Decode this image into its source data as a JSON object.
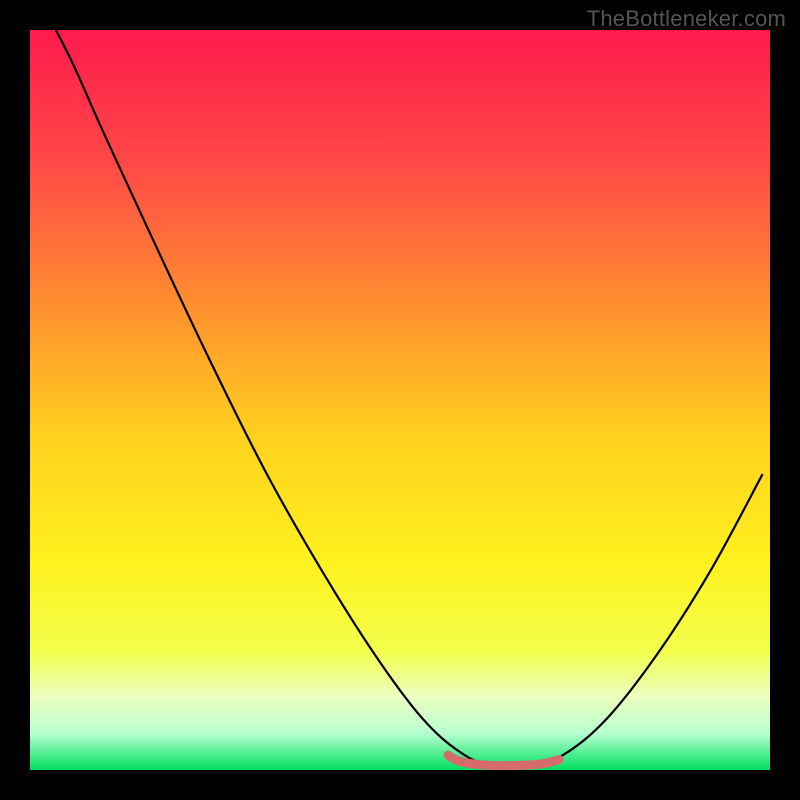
{
  "watermark": "TheBottleneker.com",
  "chart_data": {
    "type": "line",
    "title": "",
    "xlabel": "",
    "ylabel": "",
    "xlim": [
      0,
      100
    ],
    "ylim": [
      0,
      100
    ],
    "grid": false,
    "background_gradient": {
      "stops": [
        {
          "pos": 0.0,
          "color": "#ff1a4c"
        },
        {
          "pos": 0.18,
          "color": "#ff4947"
        },
        {
          "pos": 0.36,
          "color": "#ff8a30"
        },
        {
          "pos": 0.55,
          "color": "#ffd11e"
        },
        {
          "pos": 0.72,
          "color": "#fff11e"
        },
        {
          "pos": 0.84,
          "color": "#f2ff4c"
        },
        {
          "pos": 0.9,
          "color": "#ecffbf"
        },
        {
          "pos": 0.95,
          "color": "#b8ffd0"
        },
        {
          "pos": 1.0,
          "color": "#00e060"
        }
      ]
    },
    "series": [
      {
        "name": "bottleneck-curve",
        "color": "#000000",
        "width": 2.2,
        "points": [
          {
            "x": 3.5,
            "y": 100.0
          },
          {
            "x": 6.0,
            "y": 95.0
          },
          {
            "x": 10.0,
            "y": 86.0
          },
          {
            "x": 16.0,
            "y": 73.0
          },
          {
            "x": 24.0,
            "y": 56.0
          },
          {
            "x": 32.0,
            "y": 40.0
          },
          {
            "x": 40.0,
            "y": 26.0
          },
          {
            "x": 47.0,
            "y": 15.0
          },
          {
            "x": 53.0,
            "y": 7.0
          },
          {
            "x": 58.0,
            "y": 2.5
          },
          {
            "x": 62.0,
            "y": 0.8
          },
          {
            "x": 68.0,
            "y": 0.8
          },
          {
            "x": 72.0,
            "y": 2.0
          },
          {
            "x": 78.0,
            "y": 7.0
          },
          {
            "x": 85.0,
            "y": 16.0
          },
          {
            "x": 92.0,
            "y": 27.0
          },
          {
            "x": 99.0,
            "y": 40.0
          }
        ]
      }
    ],
    "highlight_segment": {
      "name": "optimal-range",
      "color": "#d66b6b",
      "width": 9,
      "points": [
        {
          "x": 56.5,
          "y": 2.0
        },
        {
          "x": 58.0,
          "y": 1.2
        },
        {
          "x": 61.0,
          "y": 0.7
        },
        {
          "x": 65.0,
          "y": 0.6
        },
        {
          "x": 69.0,
          "y": 0.8
        },
        {
          "x": 71.5,
          "y": 1.4
        }
      ]
    }
  }
}
